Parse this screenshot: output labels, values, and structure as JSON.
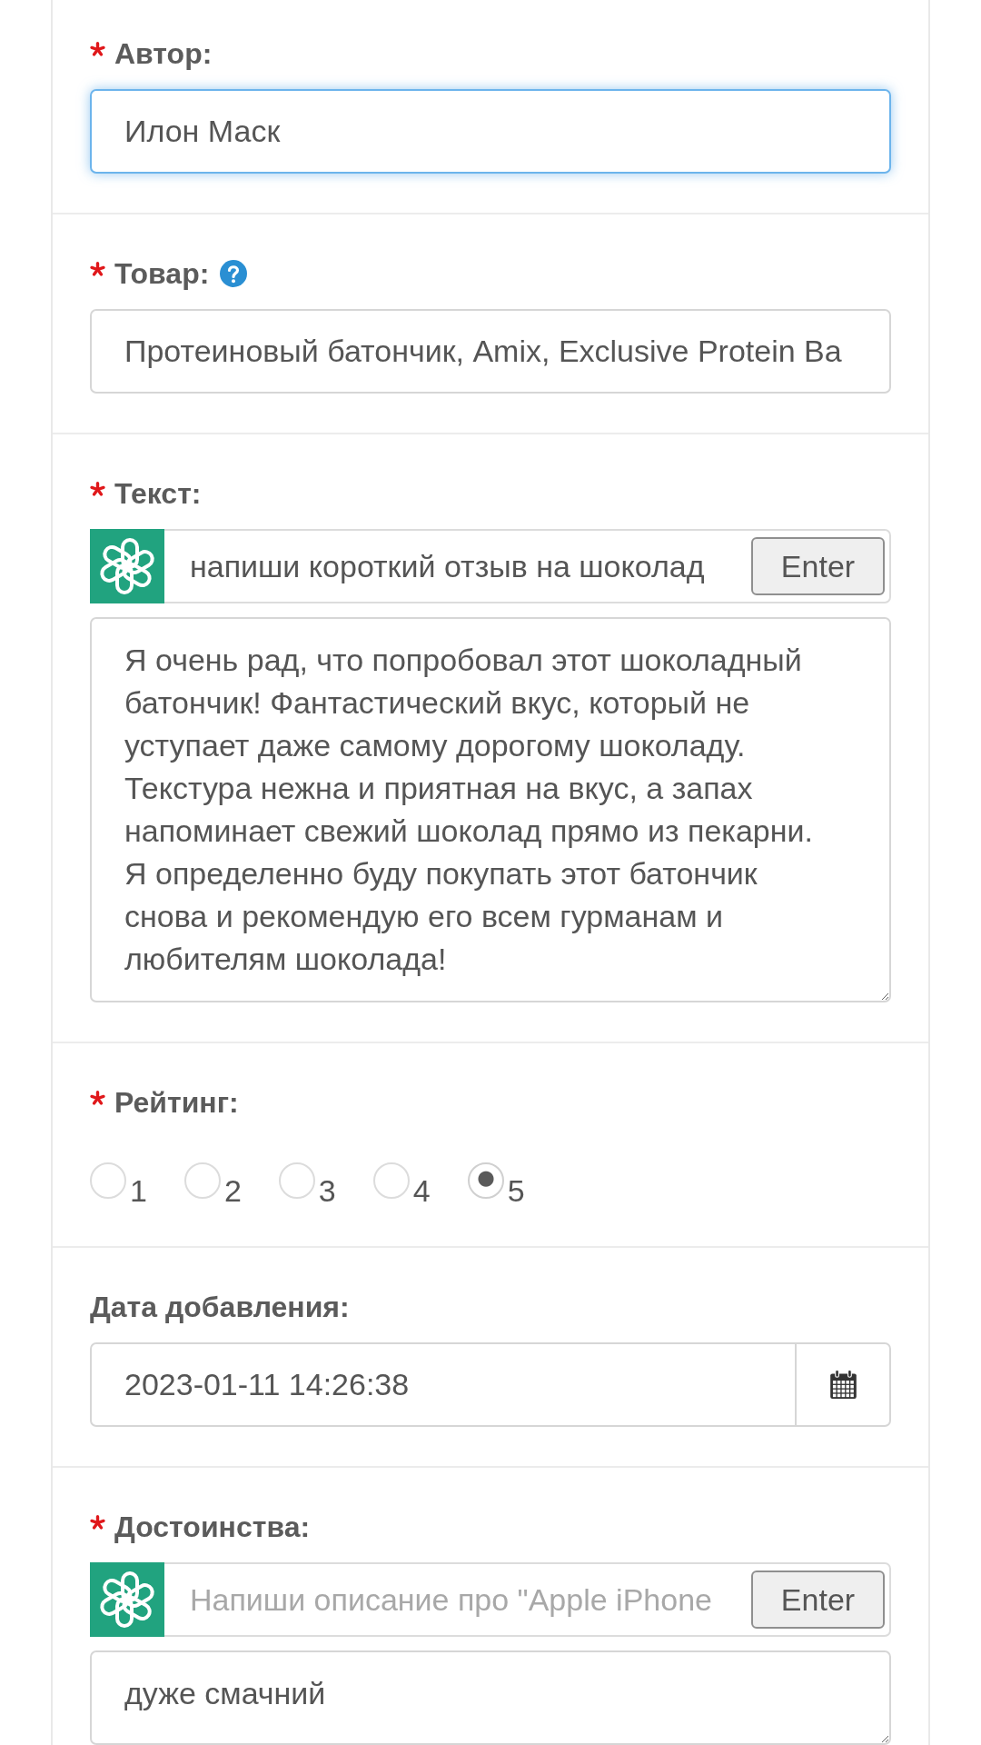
{
  "fields": [
    {
      "kind": "text",
      "label": "Автор:",
      "required": true,
      "value": "Илон Маск",
      "focused": true
    },
    {
      "kind": "text",
      "label": "Товар:",
      "required": true,
      "help": true,
      "value": "Протеиновый батончик, Amix, Exclusive Protein Ba"
    },
    {
      "kind": "ai_text",
      "label": "Текст:",
      "required": true,
      "prompt": {
        "value": "напиши короткий отзыв на шоколад",
        "button": "Enter"
      },
      "value": "Я очень рад, что попробовал этот шоколадный батончик! Фантастический вкус, который не уступает даже самому дорогому шоколаду. Текстура нежна и приятная на вкус, а запах напоминает свежий шоколад прямо из пекарни. Я определенно буду покупать этот батончик снова и рекомендую его всем гурманам и любителям шоколада!"
    },
    {
      "kind": "rating",
      "label": "Рейтинг:",
      "required": true,
      "options": [
        {
          "label": "1",
          "selected": false
        },
        {
          "label": "2",
          "selected": false
        },
        {
          "label": "3",
          "selected": false
        },
        {
          "label": "4",
          "selected": false
        },
        {
          "label": "5",
          "selected": true
        }
      ]
    },
    {
      "kind": "datetime",
      "label": "Дата добавления:",
      "required": false,
      "value": "2023-01-11 14:26:38"
    },
    {
      "kind": "ai_text",
      "label": "Достоинства:",
      "required": true,
      "prompt": {
        "placeholder": "Напиши описание про \"Apple iPhone",
        "button": "Enter"
      },
      "value": "дуже смачний"
    }
  ]
}
